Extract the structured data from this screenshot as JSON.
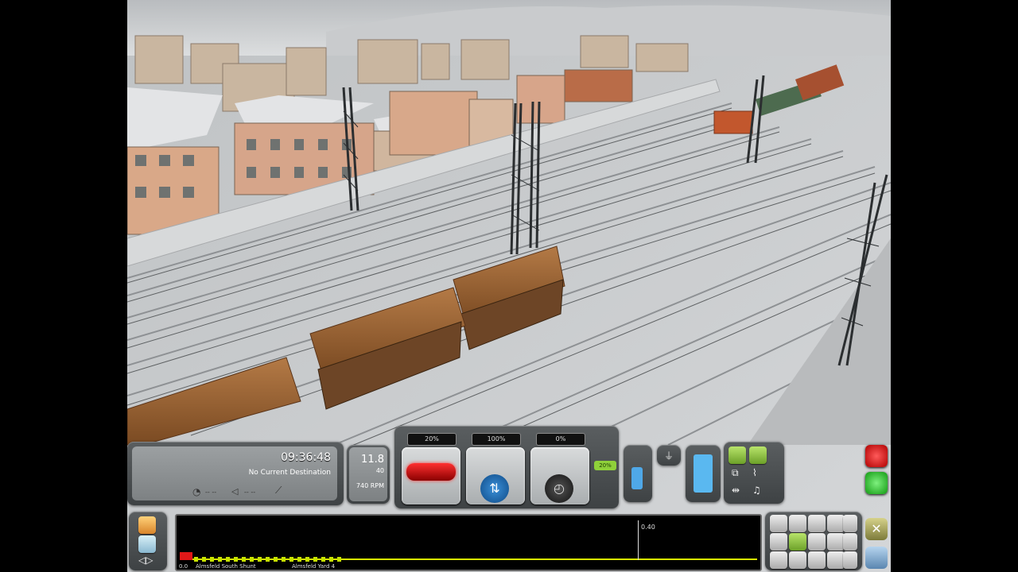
{
  "clock": {
    "time": "09:36:48",
    "destination": "No Current Destination",
    "gauge1": "-- --",
    "gauge2": "-- --"
  },
  "speed": {
    "value": "11.8",
    "limit": "40",
    "rpm": "740 RPM"
  },
  "levers": {
    "throttle": "20%",
    "reverser": "100%",
    "brake": "0%"
  },
  "small_indicator": "20%",
  "track_monitor": {
    "distance": "0.40",
    "start": "0.0",
    "station1": "Almsfeld South Shunt",
    "station2": "Almsfeld Yard 4"
  },
  "icons": {
    "left_column": [
      "map-icon",
      "notepad-icon",
      "arrows-icon"
    ],
    "right_column": [
      "stop-icon",
      "go-icon",
      "close-icon",
      "save-icon"
    ]
  },
  "colors": {
    "ui_grey": "#4a4e50",
    "accent_green": "#8fd03a",
    "accent_red": "#d62222"
  }
}
